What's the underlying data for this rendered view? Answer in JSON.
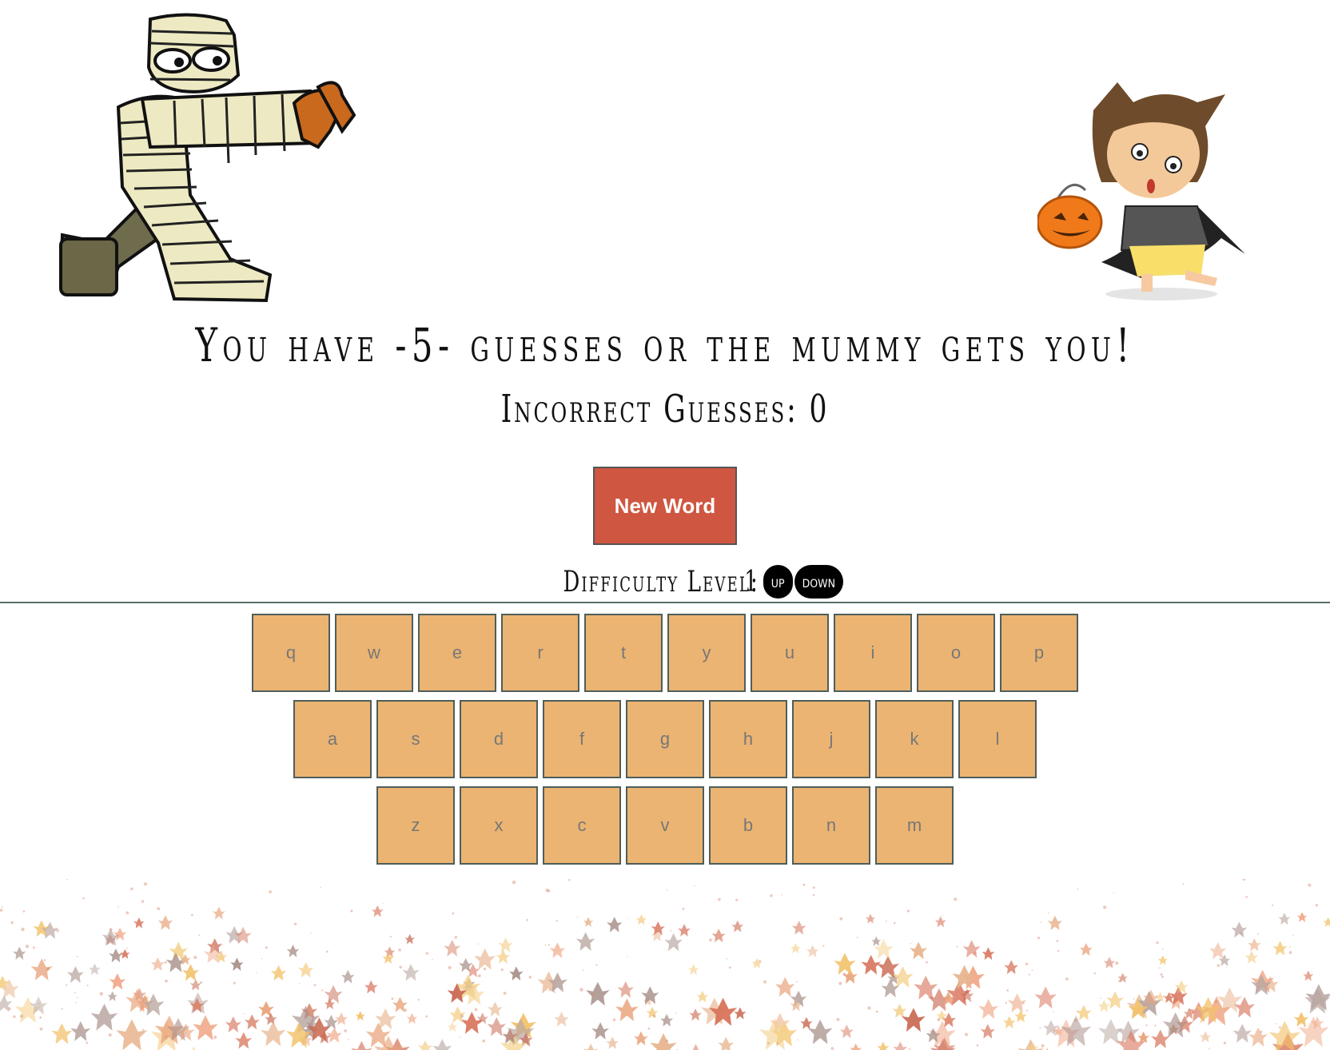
{
  "headline": "You have -5- guesses or the mummy gets you!",
  "incorrect": {
    "label": "Incorrect Guesses:",
    "value": "0"
  },
  "new_word_label": "New Word",
  "difficulty": {
    "label": "Difficulty Level:",
    "value": "1",
    "up_label": "up",
    "down_label": "down"
  },
  "keyboard": {
    "rows": [
      [
        "q",
        "w",
        "e",
        "r",
        "t",
        "y",
        "u",
        "i",
        "o",
        "p"
      ],
      [
        "a",
        "s",
        "d",
        "f",
        "g",
        "h",
        "j",
        "k",
        "l"
      ],
      [
        "z",
        "x",
        "c",
        "v",
        "b",
        "n",
        "m"
      ]
    ]
  },
  "colors": {
    "button": "#cf5640",
    "key": "#ebb472",
    "pill": "#000000"
  },
  "illustrations": [
    "mummy-illustration",
    "trick-or-treat-kid-illustration",
    "autumn-leaves-decoration"
  ]
}
